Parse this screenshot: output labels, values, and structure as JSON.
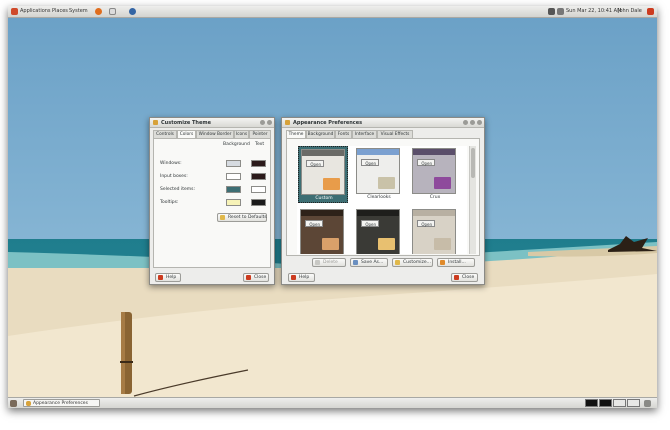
{
  "top_panel": {
    "menus": [
      "Applications",
      "Places",
      "System"
    ],
    "clock": "Sun Mar 22, 10:41 AM",
    "user": "John Dale"
  },
  "customize_window": {
    "title": "Customize Theme",
    "tabs": [
      "Controls",
      "Colors",
      "Window Border",
      "Icons",
      "Pointer"
    ],
    "active_tab": "Colors",
    "col_background": "Background",
    "col_text": "Text",
    "rows": [
      {
        "label": "Windows:",
        "bg": "#d6dbe1",
        "text": "#2b1a1a"
      },
      {
        "label": "Input boxes:",
        "bg": "#ffffff",
        "text": "#2b1a1a"
      },
      {
        "label": "Selected items:",
        "bg": "#3d6e73",
        "text": "#ffffff"
      },
      {
        "label": "Tooltips:",
        "bg": "#f7f3b8",
        "text": "#1a1a1a"
      }
    ],
    "reset_label": "Reset to Defaults",
    "help_label": "Help",
    "close_label": "Close"
  },
  "appearance_window": {
    "title": "Appearance Preferences",
    "tabs": [
      "Theme",
      "Background",
      "Fonts",
      "Interface",
      "Visual Effects"
    ],
    "active_tab": "Theme",
    "themes": [
      {
        "name": "Custom",
        "selected": true
      },
      {
        "name": "Clearlooks",
        "selected": false
      },
      {
        "name": "Crux",
        "selected": false
      },
      {
        "name": "",
        "selected": false
      },
      {
        "name": "",
        "selected": false
      },
      {
        "name": "",
        "selected": false
      }
    ],
    "thumb_open_label": "Open",
    "buttons": {
      "delete": "Delete",
      "save_as": "Save As...",
      "customize": "Customize...",
      "install": "Install..."
    },
    "help_label": "Help",
    "close_label": "Close"
  },
  "bottom_panel": {
    "task_label": "Appearance Preferences"
  },
  "colors": {
    "accent_selected": "#3d6e73",
    "close_red": "#cc3b1f"
  }
}
